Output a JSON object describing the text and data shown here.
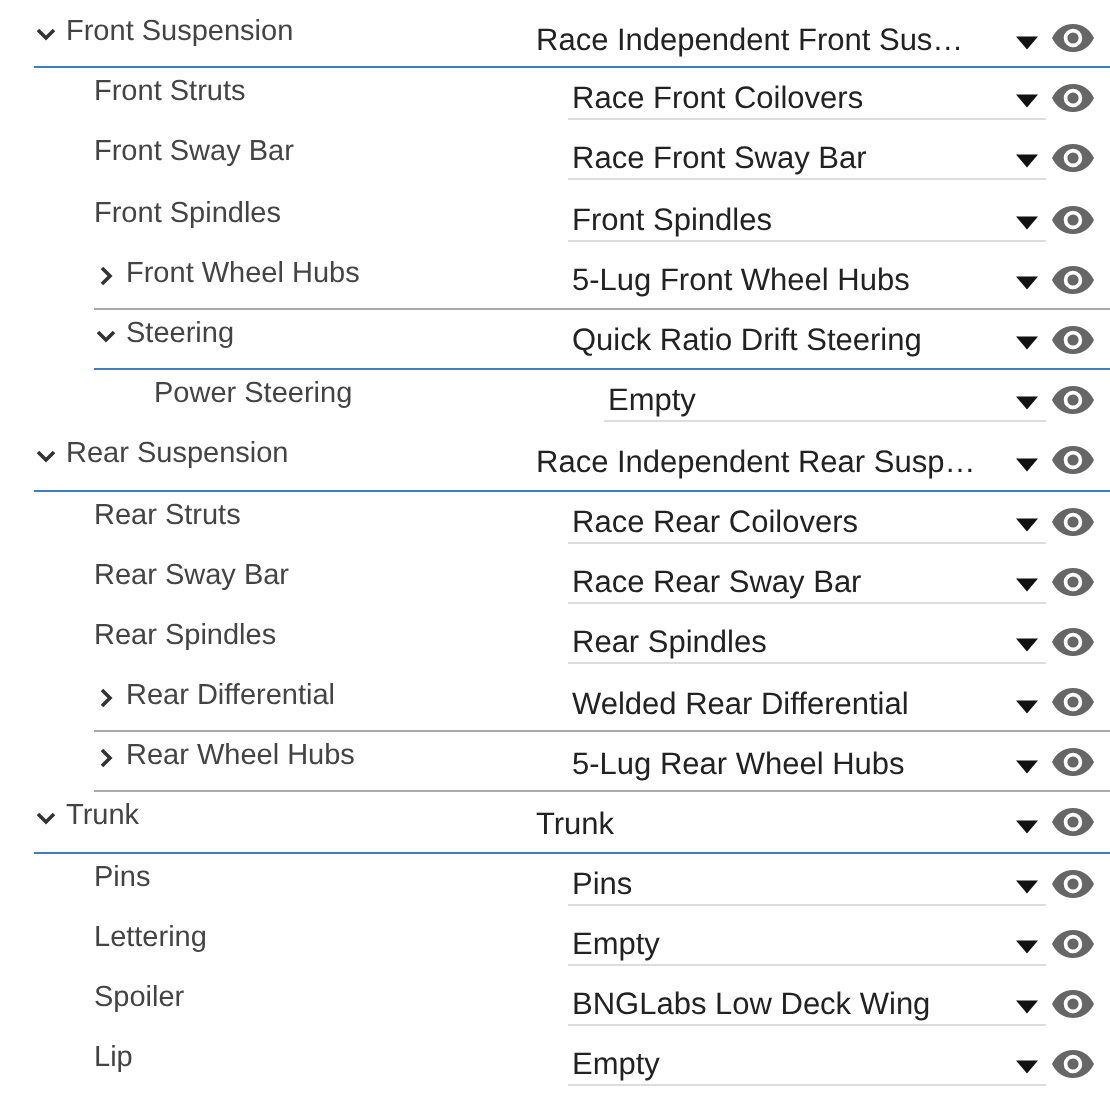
{
  "items": [
    {
      "label": "Front Suspension",
      "value": "Race Independent Front Sus…",
      "expanded": true,
      "children": [
        {
          "label": "Front Struts",
          "value": "Race Front Coilovers"
        },
        {
          "label": "Front Sway Bar",
          "value": "Race Front Sway Bar"
        },
        {
          "label": "Front Spindles",
          "value": "Front Spindles"
        },
        {
          "label": "Front Wheel Hubs",
          "value": "5-Lug Front Wheel Hubs",
          "expanded": false
        },
        {
          "label": "Steering",
          "value": "Quick Ratio Drift Steering",
          "expanded": true,
          "children": [
            {
              "label": "Power Steering",
              "value": "Empty"
            }
          ]
        }
      ]
    },
    {
      "label": "Rear Suspension",
      "value": "Race Independent Rear Susp…",
      "expanded": true,
      "children": [
        {
          "label": "Rear Struts",
          "value": "Race Rear Coilovers"
        },
        {
          "label": "Rear Sway Bar",
          "value": "Race Rear Sway Bar"
        },
        {
          "label": "Rear Spindles",
          "value": "Rear Spindles"
        },
        {
          "label": "Rear Differential",
          "value": "Welded Rear Differential",
          "expanded": false
        },
        {
          "label": "Rear Wheel Hubs",
          "value": "5-Lug Rear Wheel Hubs",
          "expanded": false
        }
      ]
    },
    {
      "label": "Trunk",
      "value": "Trunk",
      "expanded": true,
      "children": [
        {
          "label": "Pins",
          "value": "Pins"
        },
        {
          "label": "Lettering",
          "value": "Empty"
        },
        {
          "label": "Spoiler",
          "value": "BNGLabs Low Deck Wing"
        },
        {
          "label": "Lip",
          "value": "Empty"
        }
      ]
    }
  ]
}
